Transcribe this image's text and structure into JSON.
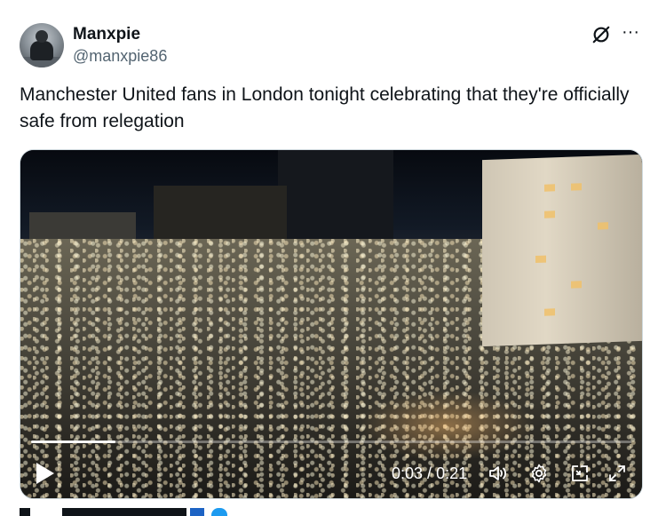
{
  "author": {
    "name": "Manxpie",
    "handle": "@manxpie86"
  },
  "tweet": {
    "text": "Manchester United fans in London tonight celebrating that they're officially safe from relegation"
  },
  "video": {
    "time_current": "0:03",
    "time_total": "0:21",
    "progress_fraction": 0.14
  },
  "icons": {
    "grok": "grok-icon",
    "more": "more-icon",
    "play": "play-icon",
    "volume": "volume-icon",
    "settings": "gear-icon",
    "pip": "picture-in-picture-icon",
    "fullscreen": "fullscreen-icon"
  }
}
